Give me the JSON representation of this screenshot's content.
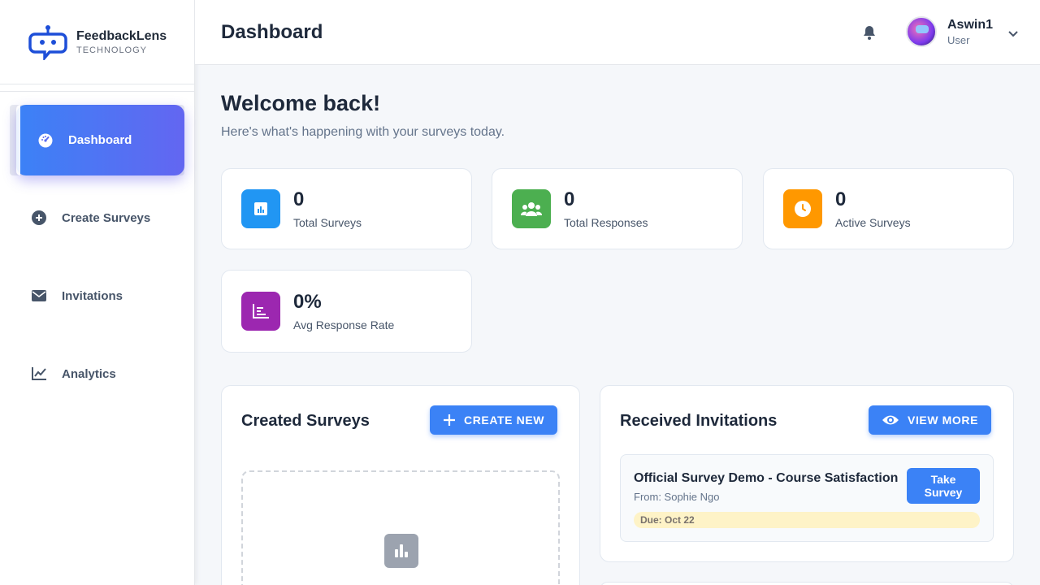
{
  "brand": {
    "name": "FeedbackLens",
    "subtitle": "TECHNOLOGY"
  },
  "sidebar": {
    "items": [
      {
        "label": "Dashboard",
        "icon": "dashboard-gauge-icon",
        "active": true
      },
      {
        "label": "Create Surveys",
        "icon": "plus-circle-icon",
        "active": false
      },
      {
        "label": "Invitations",
        "icon": "envelope-icon",
        "active": false
      },
      {
        "label": "Analytics",
        "icon": "line-chart-icon",
        "active": false
      }
    ]
  },
  "header": {
    "title": "Dashboard",
    "user": {
      "name": "Aswin1",
      "role": "User"
    }
  },
  "welcome": {
    "title": "Welcome back!",
    "subtitle": "Here's what's happening with your surveys today."
  },
  "stats": [
    {
      "value": "0",
      "label": "Total Surveys",
      "color": "#2196f3",
      "icon": "bar-chart-icon"
    },
    {
      "value": "0",
      "label": "Total Responses",
      "color": "#4caf50",
      "icon": "people-icon"
    },
    {
      "value": "0",
      "label": "Active Surveys",
      "color": "#ff9800",
      "icon": "clock-icon"
    },
    {
      "value": "0%",
      "label": "Avg Response Rate",
      "color": "#9c27b0",
      "icon": "chart-icon"
    }
  ],
  "created_surveys": {
    "title": "Created Surveys",
    "button": "CREATE NEW"
  },
  "received_invitations": {
    "title": "Received Invitations",
    "button": "VIEW MORE",
    "items": [
      {
        "title": "Official Survey Demo - Course Satisfaction",
        "from": "From: Sophie Ngo",
        "due": "Due: Oct 22",
        "action_line1": "Take",
        "action_line2": "Survey"
      }
    ]
  },
  "colors": {
    "primary": "#3b82f6",
    "accent": "#6366f1",
    "background": "#f5f7fa"
  }
}
